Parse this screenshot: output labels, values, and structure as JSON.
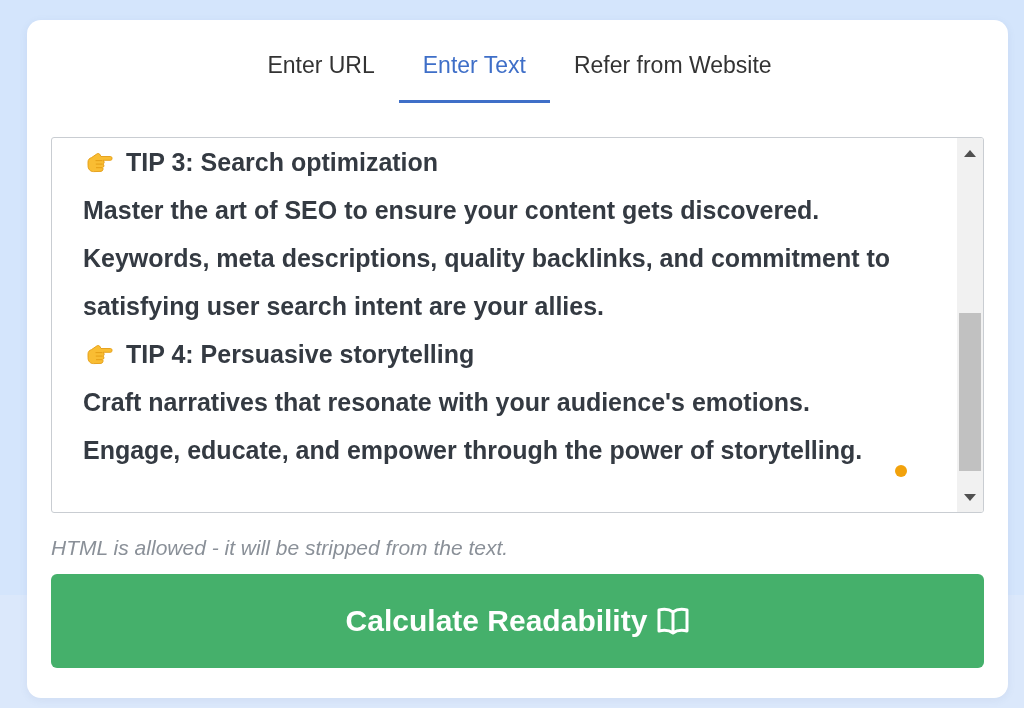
{
  "tabs": [
    {
      "label": "Enter URL",
      "selected": false
    },
    {
      "label": "Enter Text",
      "selected": true
    },
    {
      "label": "Refer from Website",
      "selected": false
    }
  ],
  "text_field": {
    "paragraphs": [
      {
        "kind": "tip",
        "text": "TIP 3: Search optimization"
      },
      {
        "kind": "body",
        "text": "Master the art of SEO to ensure your content gets discovered."
      },
      {
        "kind": "body",
        "text": "Keywords, meta descriptions, quality backlinks, and commitment to satisfying user search intent are your allies."
      },
      {
        "kind": "tip",
        "text": "TIP 4: Persuasive storytelling"
      },
      {
        "kind": "body",
        "text": "Craft narratives that resonate with your audience's emotions."
      },
      {
        "kind": "body",
        "text": "Engage, educate, and empower through the power of storytelling."
      }
    ]
  },
  "hint": "HTML is allowed - it will be stripped from the text.",
  "submit_button": {
    "label": "Calculate Readability"
  }
}
